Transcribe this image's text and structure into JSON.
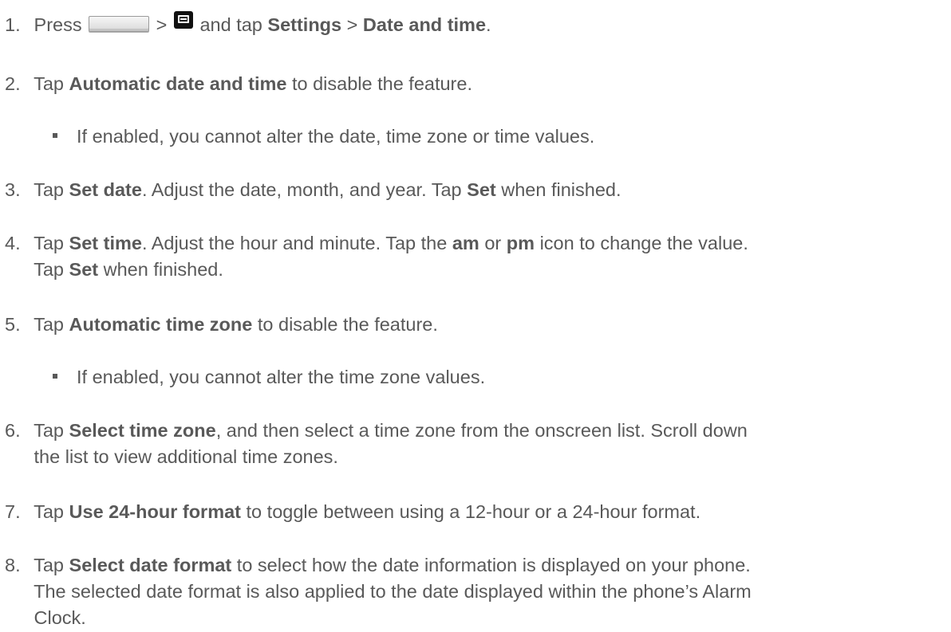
{
  "steps": [
    {
      "num": "1.",
      "t1": "Press",
      "t2": ">",
      "t3": "and tap",
      "b1": "Settings",
      "t4": ">",
      "b2": "Date and time",
      "t5": "."
    },
    {
      "num": "2.",
      "t1": "Tap",
      "b1": "Automatic date and time",
      "t2": "to disable the feature.",
      "sub": "If enabled, you cannot alter the date, time zone or time values."
    },
    {
      "num": "3.",
      "t1": "Tap",
      "b1": "Set date",
      "t2": ". Adjust the date, month, and year. Tap",
      "b2": "Set",
      "t3": "when finished."
    },
    {
      "num": "4.",
      "t1": "Tap",
      "b1": "Set time",
      "t2": ". Adjust the hour and minute. Tap the",
      "b2": "am",
      "t3": "or",
      "b3": "pm",
      "t4": "icon to change the value.",
      "t5": "Tap",
      "b4": "Set",
      "t6": "when finished."
    },
    {
      "num": "5.",
      "t1": "Tap",
      "b1": "Automatic time zone",
      "t2": "to disable the feature.",
      "sub": "If enabled, you cannot alter the time zone values."
    },
    {
      "num": "6.",
      "t1": "Tap",
      "b1": "Select time zone",
      "t2": ", and then select a time zone from the onscreen list. Scroll down",
      "t3": "the list to view additional time zones."
    },
    {
      "num": "7.",
      "t1": "Tap",
      "b1": "Use 24-hour format",
      "t2": "to toggle between using a 12-hour or a 24-hour format."
    },
    {
      "num": "8.",
      "t1": "Tap",
      "b1": "Select date format",
      "t2": "to select how the date information is displayed on your phone.",
      "t3": "The selected date format is also applied to the date displayed within the phone’s Alarm",
      "t4": "Clock."
    }
  ],
  "icons": {
    "home_key": "home-key-icon",
    "menu_key": "menu-key-icon"
  }
}
